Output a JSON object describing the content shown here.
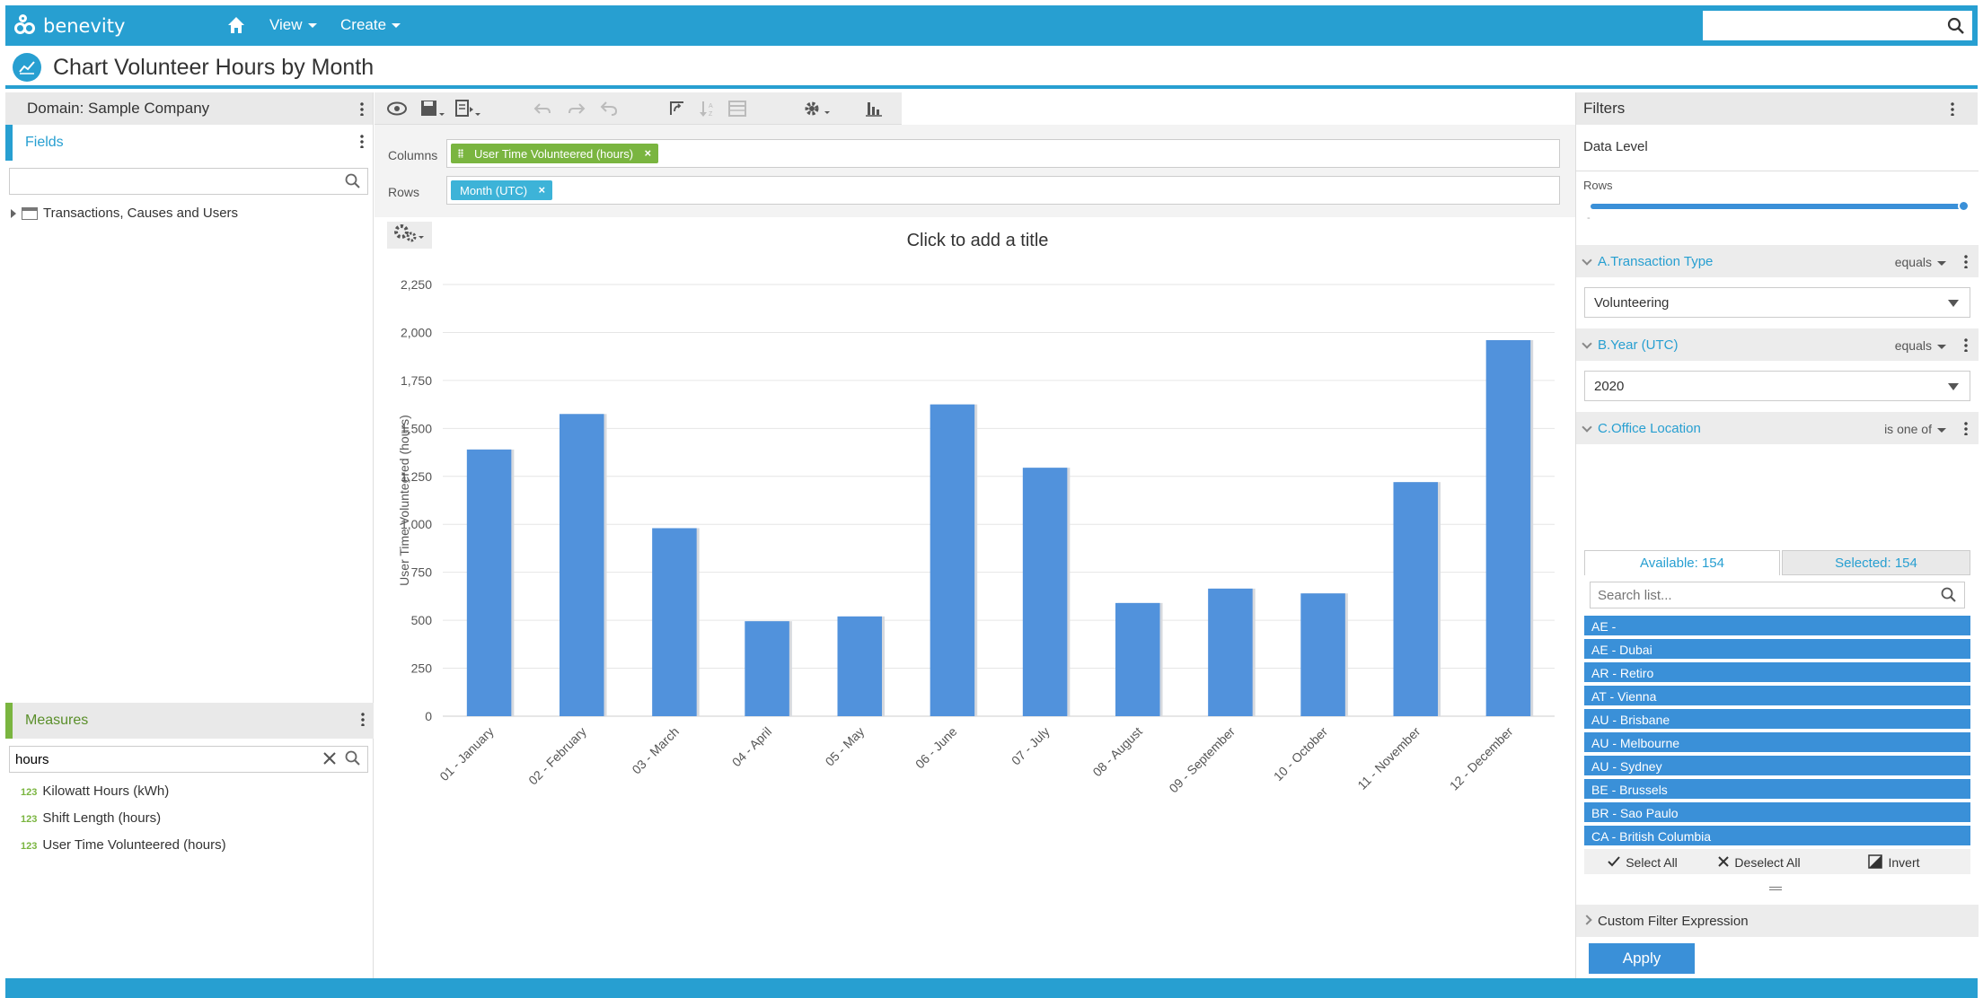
{
  "app": {
    "logo_text": "benevity"
  },
  "nav": {
    "view_label": "View",
    "create_label": "Create"
  },
  "search": {
    "placeholder": ""
  },
  "page": {
    "title": "Chart Volunteer Hours by Month"
  },
  "left": {
    "domain_label": "Domain: Sample Company",
    "fields_label": "Fields",
    "fields_search_value": "",
    "tree_item": "Transactions, Causes and Users",
    "measures_label": "Measures",
    "measures_search_value": "hours",
    "measures": [
      {
        "type": "123",
        "label": "Kilowatt Hours (kWh)"
      },
      {
        "type": "123",
        "label": "Shift Length (hours)"
      },
      {
        "type": "123",
        "label": "User Time Volunteered (hours)"
      }
    ]
  },
  "shelves": {
    "columns_label": "Columns",
    "rows_label": "Rows",
    "column_pill": "User Time Volunteered (hours)",
    "row_pill": "Month (UTC)",
    "pill_remove": "×"
  },
  "chart_data": {
    "type": "bar",
    "title": "Click to add a title",
    "ylabel": "User Time Volunteered (hours)",
    "xlabel": "",
    "ylim": [
      0,
      2250
    ],
    "yticks": [
      0,
      250,
      500,
      750,
      1000,
      1250,
      1500,
      1750,
      2000,
      2250
    ],
    "ytick_labels": [
      "0",
      "250",
      "500",
      "750",
      "1,000",
      "1,250",
      "1,500",
      "1,750",
      "2,000",
      "2,250"
    ],
    "categories": [
      "01 - January",
      "02 - February",
      "03 - March",
      "04 - April",
      "05 - May",
      "06 - June",
      "07 - July",
      "08 - August",
      "09 - September",
      "10 - October",
      "11 - November",
      "12 - December"
    ],
    "values": [
      1390,
      1575,
      980,
      495,
      520,
      1625,
      1295,
      590,
      665,
      640,
      1220,
      1960
    ],
    "bar_color": "#5192dc",
    "grid": true
  },
  "filters": {
    "header": "Filters",
    "data_level_label": "Data Level",
    "rows_label": "Rows",
    "rows_level": 1.0,
    "slider_min": "-",
    "items": [
      {
        "name": "A.Transaction Type",
        "op": "equals",
        "value": "Volunteering"
      },
      {
        "name": "B.Year (UTC)",
        "op": "equals",
        "value": "2020"
      },
      {
        "name": "C.Office Location",
        "op": "is one of"
      }
    ],
    "available_tab": "Available: 154",
    "selected_tab": "Selected: 154",
    "list_search_placeholder": "Search list...",
    "locations": [
      "AE -",
      "AE - Dubai",
      "AR - Retiro",
      "AT - Vienna",
      "AU - Brisbane",
      "AU - Melbourne",
      "AU - Sydney",
      "BE - Brussels",
      "BR - Sao Paulo",
      "CA - British Columbia"
    ],
    "select_all": "Select All",
    "deselect_all": "Deselect All",
    "invert": "Invert",
    "custom_expression": "Custom Filter Expression",
    "apply": "Apply"
  },
  "colors": {
    "brand": "#279fd1",
    "bar": "#5192dc",
    "measure": "#7ab540"
  }
}
